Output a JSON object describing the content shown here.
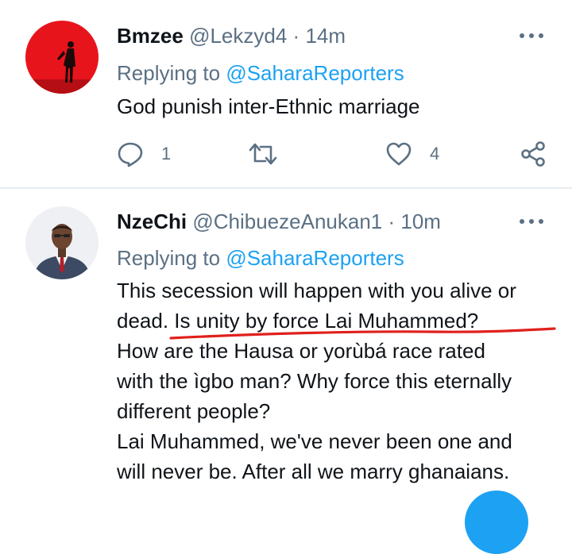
{
  "tweets": [
    {
      "name": "Bmzee",
      "handle": "@Lekzyd4",
      "separator": "·",
      "time": "14m",
      "replying_prefix": "Replying to",
      "replying_to": "@SaharaReporters",
      "text": "God punish inter-Ethnic marriage",
      "reply_count": "1",
      "like_count": "4"
    },
    {
      "name": "NzeChi",
      "handle": "@ChibuezeAnukan1",
      "separator": "·",
      "time": "10m",
      "replying_prefix": "Replying to",
      "replying_to": "@SaharaReporters",
      "lines": [
        "This secession will happen with you alive or",
        "dead. Is unity by force Lai Muhammed?",
        "How are the Hausa or yorùbá race rated",
        "with the ìgbo man? Why force this eternally",
        "different people?",
        "Lai Muhammed, we've never been one and",
        "will never be. After all we marry ghanaians."
      ]
    }
  ],
  "colors": {
    "accent": "#1da1f2",
    "secondary_text": "#5b7083",
    "annotation_red": "#e0201c",
    "avatar1_bg": "#e8141c"
  },
  "icons": [
    "reply-icon",
    "retweet-icon",
    "like-icon",
    "share-icon",
    "more-icon"
  ]
}
